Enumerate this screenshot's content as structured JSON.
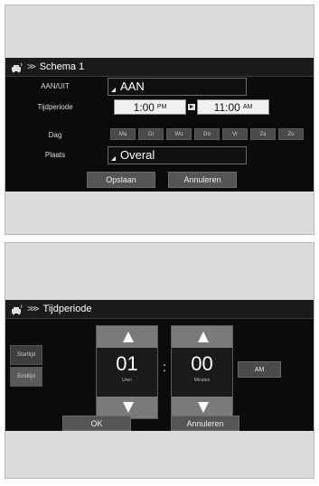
{
  "schedule_screen": {
    "title": "Schema 1",
    "labels": {
      "onoff": "AAN/UIT",
      "period": "Tijdperiode",
      "day": "Dag",
      "place": "Plaats"
    },
    "onoff_value": "AAN",
    "start_time": "1:00",
    "start_ampm": "PM",
    "end_time": "11:00",
    "end_ampm": "AM",
    "days": [
      "Ma",
      "Di",
      "Wo",
      "Do",
      "Vr",
      "Za",
      "Zo"
    ],
    "place_value": "Overal",
    "save_label": "Opslaan",
    "cancel_label": "Annuleren"
  },
  "period_screen": {
    "title": "Tijdperiode",
    "start_tab": "Starttijd",
    "end_tab": "Eindtijd",
    "hours_value": "01",
    "hours_unit": "Uren",
    "minutes_value": "00",
    "minutes_unit": "Minuten",
    "colon": ":",
    "ampm": "AM",
    "ok_label": "OK",
    "cancel_label": "Annuleren"
  }
}
